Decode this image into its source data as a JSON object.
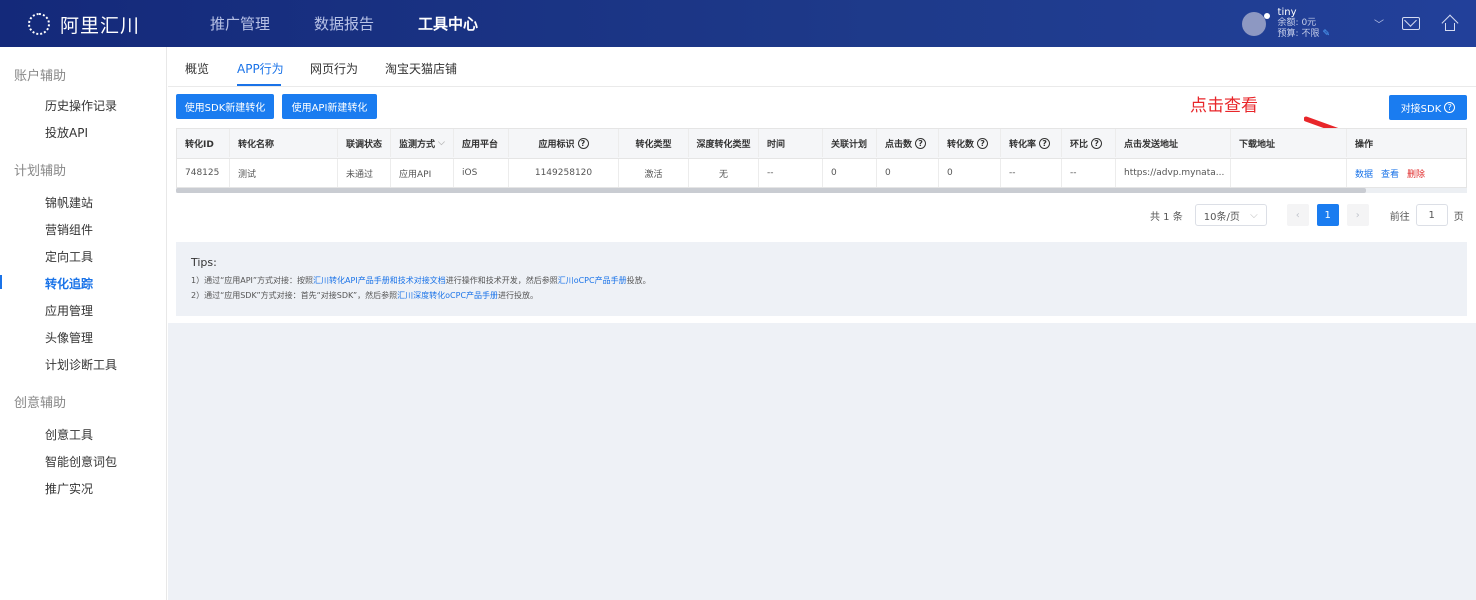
{
  "header": {
    "logo_text": "阿里汇川",
    "nav": [
      "推广管理",
      "数据报告",
      "工具中心"
    ],
    "active_nav": "工具中心",
    "user": {
      "name": "tiny",
      "balance": "余额: 0元",
      "budget": "预算: 不限"
    }
  },
  "sidebar": {
    "groups": [
      {
        "title": "账户辅助",
        "items": [
          "历史操作记录",
          "投放API"
        ]
      },
      {
        "title": "计划辅助",
        "items": [
          "锦帆建站",
          "营销组件",
          "定向工具",
          "转化追踪",
          "应用管理",
          "头像管理",
          "计划诊断工具"
        ]
      },
      {
        "title": "创意辅助",
        "items": [
          "创意工具",
          "智能创意词包",
          "推广实况"
        ]
      }
    ],
    "active_item": "转化追踪"
  },
  "tabs": [
    "概览",
    "APP行为",
    "网页行为",
    "淘宝天猫店铺"
  ],
  "active_tab": "APP行为",
  "toolbar": {
    "sdk_button": "使用SDK新建转化",
    "api_button": "使用API新建转化",
    "connect_sdk_button": "对接SDK"
  },
  "annotation": "点击查看",
  "table": {
    "columns": [
      "转化ID",
      "转化名称",
      "联调状态",
      "监测方式",
      "应用平台",
      "应用标识",
      "转化类型",
      "深度转化类型",
      "时间",
      "关联计划",
      "点击数",
      "转化数",
      "转化率",
      "环比",
      "点击发送地址",
      "下载地址",
      "操作"
    ],
    "rows": [
      [
        "748125",
        "测试",
        "未通过",
        "应用API",
        "iOS",
        "1149258120",
        "激活",
        "无",
        "--",
        "0",
        "0",
        "0",
        "--",
        "--",
        "https://advp.mynata...",
        ""
      ]
    ],
    "actions": [
      "数据",
      "查看",
      "删除"
    ]
  },
  "pagination": {
    "total": "共 1 条",
    "page_size": "10条/页",
    "current_page": "1",
    "goto_label": "前往",
    "goto_value": "1",
    "page_unit": "页"
  },
  "tips": {
    "title": "Tips:",
    "line1": {
      "prefix": "1）通过“应用API”方式对接：按照",
      "link1": "汇川转化API产品手册和技术对接文档",
      "middle": "进行操作和技术开发，然后参照",
      "link2": "汇川oCPC产品手册",
      "suffix": "投放。"
    },
    "line2": {
      "prefix": "2）通过“应用SDK”方式对接：首先“对接SDK”，然后参照",
      "link1": "汇川深度转化oCPC产品手册",
      "suffix": "进行投放。"
    }
  },
  "colors": {
    "primary": "#1a7cf0",
    "header_bg": "#1a3382",
    "danger": "#e02a2a",
    "annotation": "#e8262a"
  }
}
